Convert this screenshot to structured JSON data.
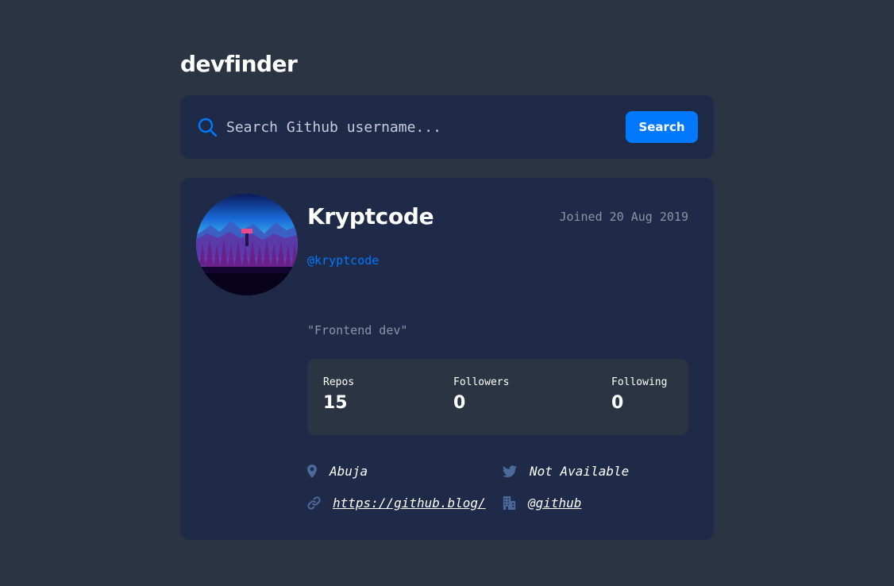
{
  "app": {
    "logo": "devfinder"
  },
  "search": {
    "placeholder": "Search Github username...",
    "value": "",
    "button_label": "Search",
    "icon": "search-icon"
  },
  "profile": {
    "name": "Kryptcode",
    "joined": "Joined 20 Aug 2019",
    "handle": "@kryptcode",
    "bio": "\"Frontend dev\"",
    "avatar": "avatar-image"
  },
  "stats": [
    {
      "label": "Repos",
      "value": "15"
    },
    {
      "label": "Followers",
      "value": "0"
    },
    {
      "label": "Following",
      "value": "0"
    }
  ],
  "links": {
    "location": {
      "icon": "location-pin-icon",
      "text": "Abuja"
    },
    "twitter": {
      "icon": "twitter-icon",
      "text": "Not Available"
    },
    "website": {
      "icon": "link-icon",
      "text": "https://github.blog/"
    },
    "company": {
      "icon": "building-icon",
      "text": "@github"
    }
  },
  "colors": {
    "background": "#2b3442",
    "card": "#1e2a47",
    "accent": "#0079ff",
    "muted": "#8b94a8",
    "icon": "#4b6a9b"
  }
}
